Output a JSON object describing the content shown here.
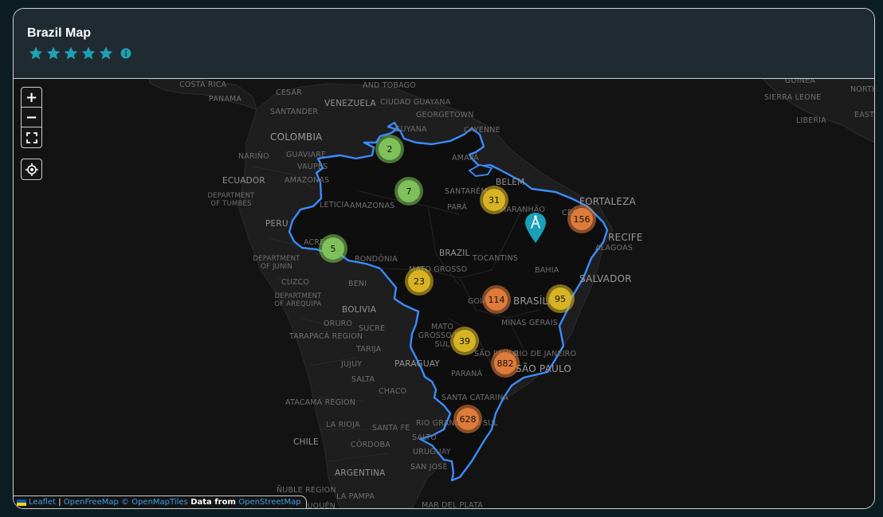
{
  "header": {
    "title": "Brazil Map",
    "rating": 5,
    "star_color": "#1ea0b4",
    "info_icon": "info-icon"
  },
  "controls": {
    "zoom_in": "+",
    "zoom_out": "−",
    "fullscreen_icon": "fullscreen-icon",
    "locate_icon": "locate-icon"
  },
  "labels": [
    {
      "text": "COSTA RICA"
    },
    {
      "text": "PANAMA"
    },
    {
      "text": "CESAR"
    },
    {
      "text": "SANTANDER"
    },
    {
      "text": "AND TOBAGO"
    },
    {
      "text": "VENEZUELA"
    },
    {
      "text": "CIUDAD GUAYANA"
    },
    {
      "text": "GEORGETOWN"
    },
    {
      "text": "GUYANA"
    },
    {
      "text": "CAYENNE"
    },
    {
      "text": "COLOMBIA"
    },
    {
      "text": "NARIÑO"
    },
    {
      "text": "GUAVIARE"
    },
    {
      "text": "VAUPÉS"
    },
    {
      "text": "AMAZONAS"
    },
    {
      "text": "AMAPÁ"
    },
    {
      "text": "ECUADOR"
    },
    {
      "text": "BELÉM"
    },
    {
      "text": "SANTARÉM"
    },
    {
      "text": "DEPARTMENT OF TUMBES"
    },
    {
      "text": "LETICIA"
    },
    {
      "text": "AMAZONAS"
    },
    {
      "text": "PARÁ"
    },
    {
      "text": "MARANHÃO"
    },
    {
      "text": "FORTALEZA"
    },
    {
      "text": "CEARÁ"
    },
    {
      "text": "RECIFE"
    },
    {
      "text": "PERU"
    },
    {
      "text": "ACRE"
    },
    {
      "text": "BRAZIL"
    },
    {
      "text": "ALAGOAS"
    },
    {
      "text": "DEPARTMENT OF JUNÍN"
    },
    {
      "text": "RONDÔNIA"
    },
    {
      "text": "TOCANTINS"
    },
    {
      "text": "MATO GROSSO"
    },
    {
      "text": "BAHIA"
    },
    {
      "text": "SALVADOR"
    },
    {
      "text": "CUZCO"
    },
    {
      "text": "BENI"
    },
    {
      "text": "DEPARTMENT OF AREQUIPA"
    },
    {
      "text": "GOIÁS"
    },
    {
      "text": "BRASÍLIA"
    },
    {
      "text": "BOLIVIA"
    },
    {
      "text": "ORURO"
    },
    {
      "text": "SUCRE"
    },
    {
      "text": "MINAS GERAIS"
    },
    {
      "text": "MATO GROSSO DO SUL"
    },
    {
      "text": "TARAPACÁ REGION"
    },
    {
      "text": "TARIJA"
    },
    {
      "text": "SÃO PAULO"
    },
    {
      "text": "RIO DE JANEIRO"
    },
    {
      "text": "SÃO PAULO"
    },
    {
      "text": "JUJUY"
    },
    {
      "text": "PARAGUAY"
    },
    {
      "text": "PARANÁ"
    },
    {
      "text": "SALTA"
    },
    {
      "text": "CHACO"
    },
    {
      "text": "ATACAMA REGION"
    },
    {
      "text": "SANTA CATARINA"
    },
    {
      "text": "LA RIOJA"
    },
    {
      "text": "RIO GRANDE DO SUL"
    },
    {
      "text": "SANTA FE"
    },
    {
      "text": "SALTO"
    },
    {
      "text": "CHILE"
    },
    {
      "text": "CÓRDOBA"
    },
    {
      "text": "URUGUAY"
    },
    {
      "text": "SAN JOSÉ"
    },
    {
      "text": "ARGENTINA"
    },
    {
      "text": "ÑUBLE REGION"
    },
    {
      "text": "LA PAMPA"
    },
    {
      "text": "MAR DEL PLATA"
    },
    {
      "text": "NEUQUÉN"
    },
    {
      "text": "GUINEA"
    },
    {
      "text": "SIERRA LEONE"
    },
    {
      "text": "LIBERIA"
    },
    {
      "text": "NORTH"
    },
    {
      "text": "EAST"
    }
  ],
  "clusters": [
    {
      "count": "2",
      "color": "green"
    },
    {
      "count": "7",
      "color": "green"
    },
    {
      "count": "31",
      "color": "yellow"
    },
    {
      "count": "156",
      "color": "orange"
    },
    {
      "count": "5",
      "color": "green"
    },
    {
      "count": "23",
      "color": "yellow"
    },
    {
      "count": "114",
      "color": "orange"
    },
    {
      "count": "95",
      "color": "yellow"
    },
    {
      "count": "39",
      "color": "yellow"
    },
    {
      "count": "882",
      "color": "orange"
    },
    {
      "count": "628",
      "color": "orange"
    }
  ],
  "marker": {
    "icon": "compass-pin-icon",
    "color": "#1a9fb8"
  },
  "border_color": "#3b8cff",
  "attribution": {
    "leaflet": "Leaflet",
    "sep": " | ",
    "openfreemap": "OpenFreeMap",
    "openmaptiles": "© OpenMapTiles",
    "data_from": " Data from ",
    "osm": "OpenStreetMap"
  }
}
